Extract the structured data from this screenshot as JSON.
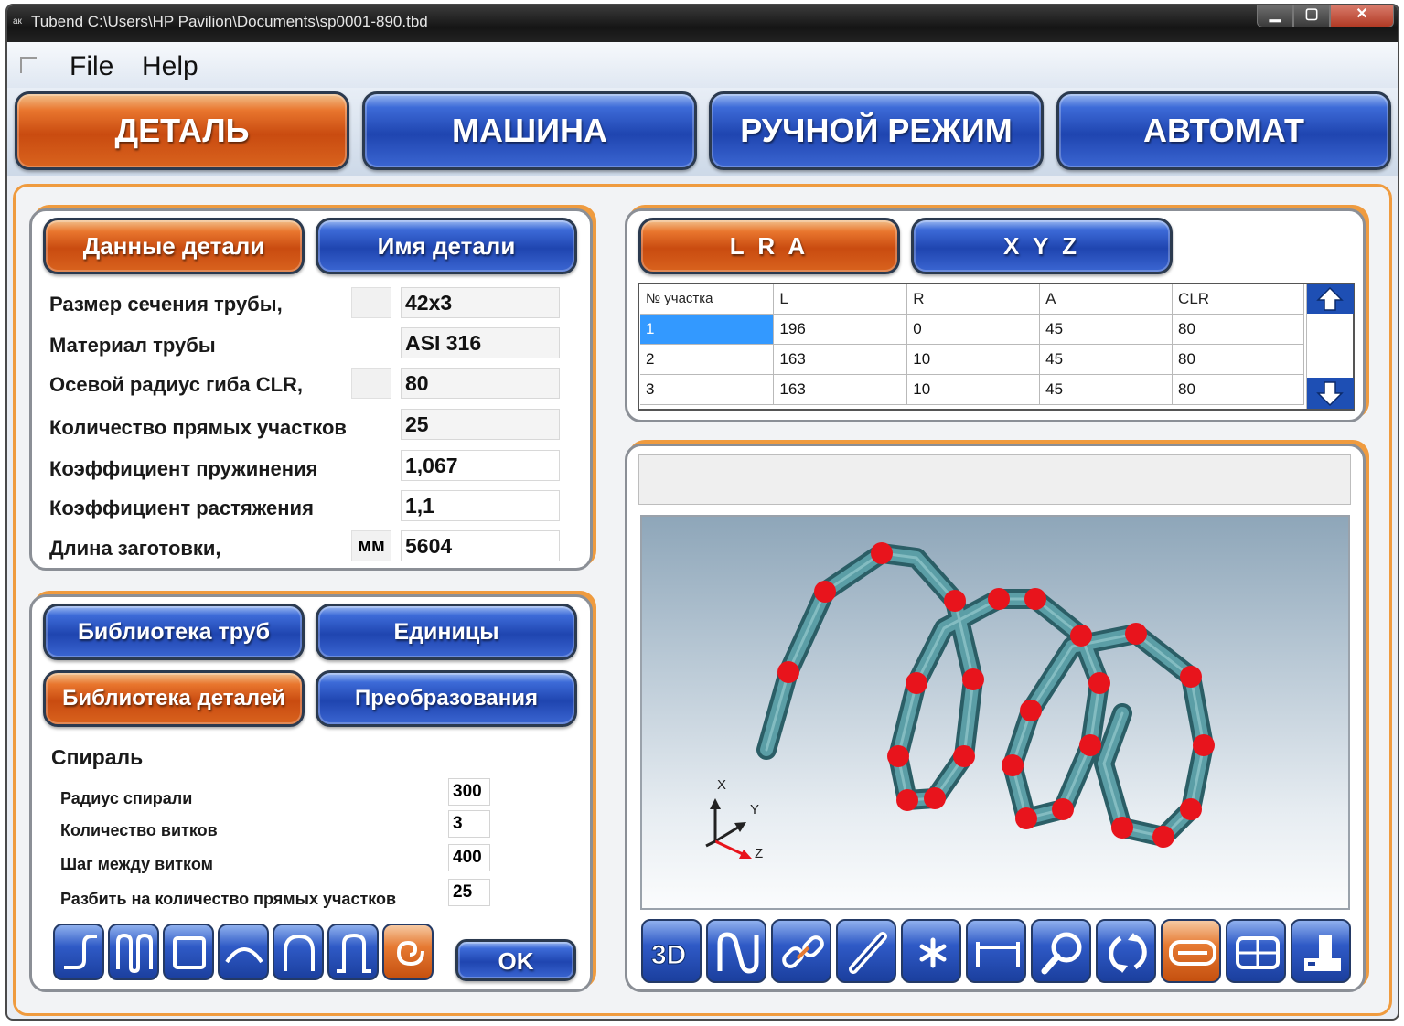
{
  "window": {
    "app_icon": "ак",
    "title": "Tubend C:\\Users\\HP Pavilion\\Documents\\sp0001-890.tbd",
    "minimize_icon": "minimize-icon",
    "maximize_icon": "maximize-icon",
    "close_icon": "close-icon"
  },
  "menu": {
    "file": "File",
    "help": "Help"
  },
  "main_tabs": [
    {
      "label": "ДЕТАЛЬ",
      "active": true
    },
    {
      "label": "МАШИНА",
      "active": false
    },
    {
      "label": "РУЧНОЙ РЕЖИМ",
      "active": false
    },
    {
      "label": "АВТОМАТ",
      "active": false
    }
  ],
  "part_panel": {
    "tab_data": "Данные детали",
    "tab_name": "Имя детали",
    "rows": [
      {
        "label": "Размер сечения трубы,",
        "unit": "",
        "value": "42x3"
      },
      {
        "label": "Материал трубы",
        "unit": "",
        "value": "ASI 316"
      },
      {
        "label": "Осевой радиус гиба CLR,",
        "unit": "",
        "value": "80"
      },
      {
        "label": "Количество прямых участков",
        "unit": "",
        "value": "25"
      },
      {
        "label": "Коэффициент пружинения",
        "unit": "",
        "value": "1,067"
      },
      {
        "label": "Коэффициент растяжения",
        "unit": "",
        "value": "1,1"
      },
      {
        "label": "Длина заготовки,",
        "unit": "мм",
        "value": "5604"
      }
    ]
  },
  "library_panel": {
    "btn_tube_lib": "Библиотека труб",
    "btn_units": "Единицы",
    "btn_part_lib": "Библиотека деталей",
    "btn_transform": "Преобразования",
    "spiral_title": "Спираль",
    "spiral_rows": [
      {
        "label": "Радиус спирали",
        "value": "300"
      },
      {
        "label": "Количество витков",
        "value": "3"
      },
      {
        "label": "Шаг между витком",
        "value": "400"
      },
      {
        "label": "Разбить на количество прямых участков",
        "value": "25"
      }
    ],
    "ok": "OK",
    "shape_icons": [
      "bend-shape-icon",
      "meander-shape-icon",
      "square-shape-icon",
      "arc-shape-icon",
      "u-shape-icon",
      "omega-shape-icon",
      "spiral-shape-icon"
    ]
  },
  "table_panel": {
    "tab_lra": "L R A",
    "tab_xyz": "X Y Z",
    "columns": [
      "№ участка",
      "L",
      "R",
      "A",
      "CLR"
    ],
    "rows": [
      [
        "1",
        "196",
        "0",
        "45",
        "80"
      ],
      [
        "2",
        "163",
        "10",
        "45",
        "80"
      ],
      [
        "3",
        "163",
        "10",
        "45",
        "80"
      ]
    ],
    "scroll_up_icon": "arrow-up-icon",
    "scroll_down_icon": "arrow-down-icon"
  },
  "view_panel": {
    "axis_x": "X",
    "axis_y": "Y",
    "axis_z": "Z",
    "colors": {
      "tube": "#4e8f98",
      "bend": "#e8141c",
      "accent_orange": "#ef9b3f",
      "button_blue": "#2f5ac6"
    },
    "tools": [
      {
        "icon": "3d-view-icon",
        "text": "3D"
      },
      {
        "icon": "bend-path-icon",
        "text": ""
      },
      {
        "icon": "link-icon",
        "text": ""
      },
      {
        "icon": "tube-icon",
        "text": ""
      },
      {
        "icon": "asterisk-icon",
        "text": ""
      },
      {
        "icon": "measure-icon",
        "text": ""
      },
      {
        "icon": "zoom-icon",
        "text": ""
      },
      {
        "icon": "rotate-icon",
        "text": ""
      },
      {
        "icon": "collision-icon",
        "text": ""
      },
      {
        "icon": "fit-view-icon",
        "text": ""
      },
      {
        "icon": "print-icon",
        "text": ""
      }
    ]
  }
}
